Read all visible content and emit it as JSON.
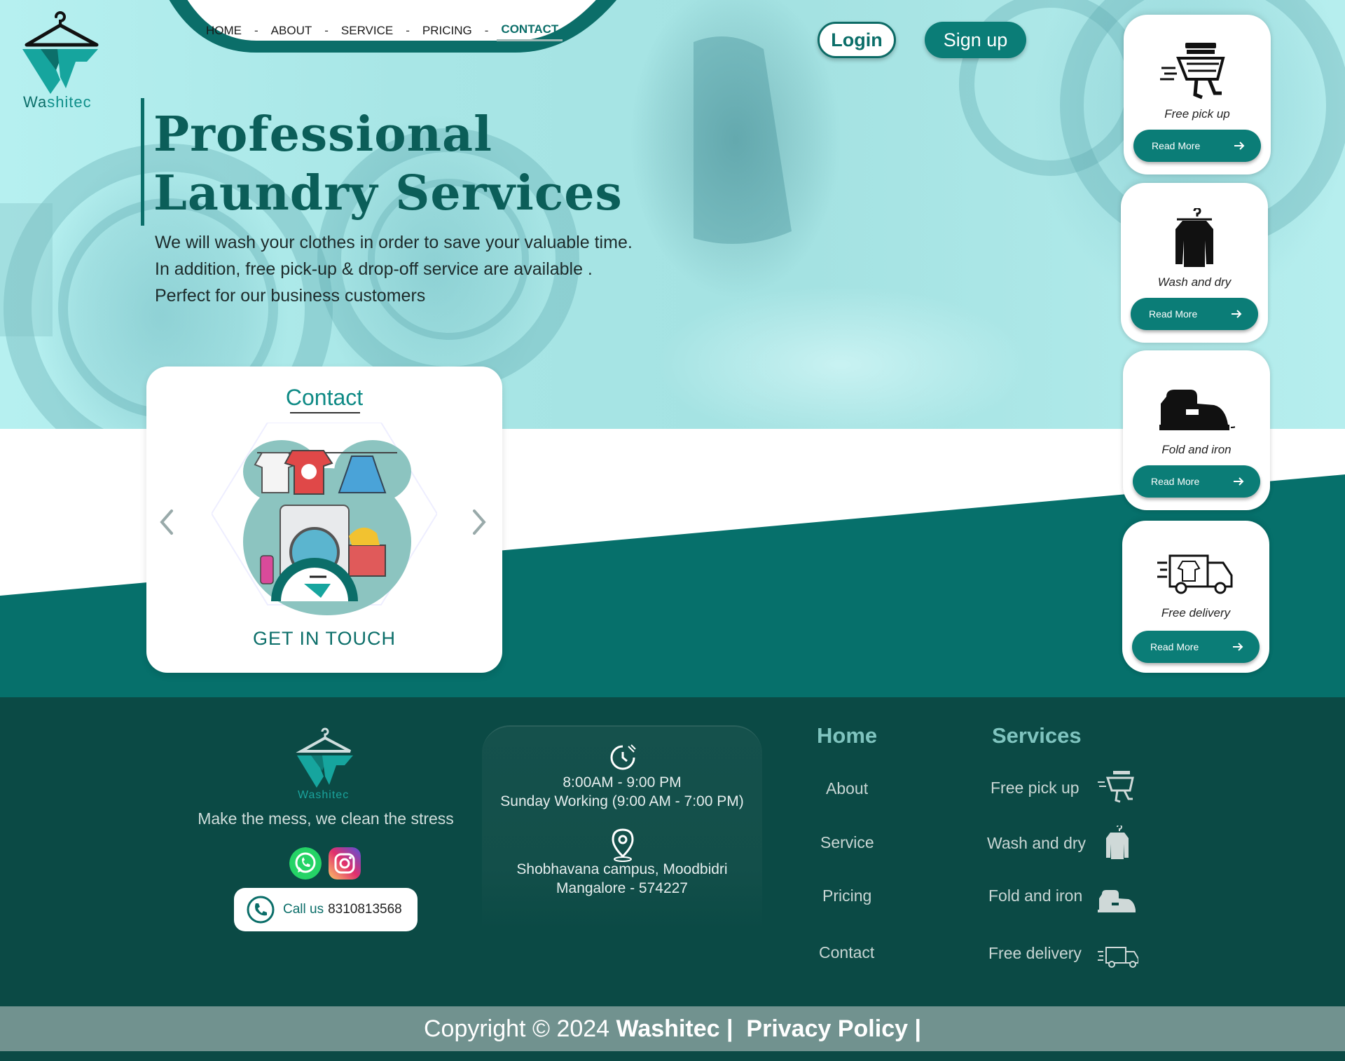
{
  "brand": {
    "name": "Washitec",
    "logo_text_a": "Wa",
    "logo_text_b": "shitec"
  },
  "nav": {
    "items": [
      "HOME",
      "ABOUT",
      "SERVICE",
      "PRICING",
      "CONTACT"
    ],
    "separator": "-",
    "active": "CONTACT"
  },
  "auth": {
    "login": "Login",
    "signup": "Sign up"
  },
  "hero": {
    "title_line1": "Professional",
    "title_line2": "Laundry Services",
    "intro_line1": "We will wash your clothes in order to save your valuable time.",
    "intro_line2": "In addition, free pick-up & drop-off service are available .",
    "intro_line3": "Perfect for our business customers"
  },
  "contact_card": {
    "title": "Contact",
    "cta": "GET IN TOUCH"
  },
  "services": [
    {
      "label": "Free pick up",
      "button": "Read More",
      "icon": "shopping-cart-runner-icon"
    },
    {
      "label": "Wash and dry",
      "button": "Read More",
      "icon": "shirt-on-hanger-icon"
    },
    {
      "label": "Fold and iron",
      "button": "Read More",
      "icon": "iron-icon"
    },
    {
      "label": "Free delivery",
      "button": "Read More",
      "icon": "delivery-truck-icon"
    }
  ],
  "footer": {
    "logo_text": "Washitec",
    "tagline": "Make the mess, we clean the stress",
    "call_label": "Call us",
    "call_number": "8310813568",
    "hours_line1": "8:00AM - 9:00 PM",
    "hours_line2": "Sunday Working (9:00 AM - 7:00 PM)",
    "address_line1": "Shobhavana campus, Moodbidri",
    "address_line2": "Mangalore - 574227",
    "home_title": "Home",
    "links": [
      "About",
      "Service",
      "Pricing",
      "Contact"
    ],
    "services_title": "Services",
    "service_links": [
      "Free pick up",
      "Wash and dry",
      "Fold and iron",
      "Free delivery"
    ]
  },
  "copyright": {
    "prefix": "Copyright © 2024",
    "brand": "Washitec",
    "sep": "|",
    "policy": "Privacy Policy"
  },
  "colors": {
    "teal_dark": "#0b4a45",
    "teal": "#06706b",
    "accent": "#0b7d77",
    "hero_bg": "#a8e6e6",
    "copy_bar": "#71928f"
  }
}
